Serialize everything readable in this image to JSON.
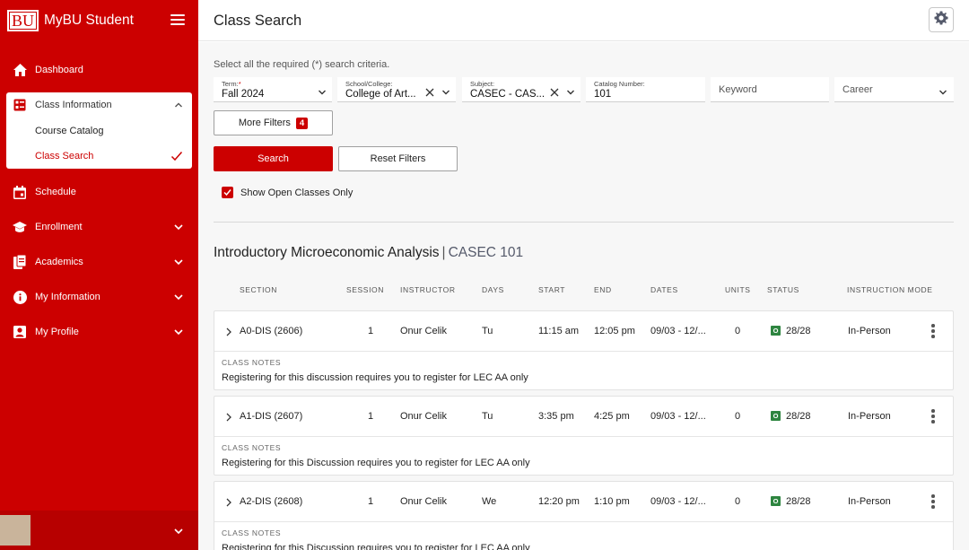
{
  "app": {
    "logo_text": "BU",
    "title": "MyBU Student"
  },
  "colors": {
    "brand": "#cc0000",
    "status_open": "#2e8540"
  },
  "sidebar": {
    "items": [
      {
        "label": "Dashboard",
        "icon": "home-icon"
      },
      {
        "label": "Class Information",
        "icon": "class-info-icon",
        "expanded": true,
        "children": [
          {
            "label": "Course Catalog"
          },
          {
            "label": "Class Search",
            "selected": true
          }
        ]
      },
      {
        "label": "Schedule",
        "icon": "calendar-icon"
      },
      {
        "label": "Enrollment",
        "icon": "graduation-cap-icon"
      },
      {
        "label": "Academics",
        "icon": "documents-icon"
      },
      {
        "label": "My Information",
        "icon": "info-icon"
      },
      {
        "label": "My Profile",
        "icon": "profile-icon"
      }
    ]
  },
  "header": {
    "title": "Class Search"
  },
  "form": {
    "hint": "Select all the required (*) search criteria.",
    "term": {
      "label": "Term:",
      "required_mark": "*",
      "value": "Fall 2024"
    },
    "school": {
      "label": "School/College:",
      "value": "College of Art..."
    },
    "subject": {
      "label": "Subject:",
      "value": "CASEC - CAS..."
    },
    "catalog": {
      "label": "Catalog Number:",
      "value": "101"
    },
    "keyword": {
      "placeholder": "Keyword"
    },
    "career": {
      "placeholder": "Career"
    },
    "more_filters": {
      "label": "More Filters",
      "count": "4"
    },
    "search_label": "Search",
    "reset_label": "Reset Filters",
    "open_only": {
      "label": "Show Open Classes Only",
      "checked": true
    }
  },
  "results": {
    "course_name": "Introductory Microeconomic Analysis",
    "separator": "|",
    "course_code": "CASEC 101",
    "columns": [
      "SECTION",
      "SESSION",
      "INSTRUCTOR",
      "DAYS",
      "START",
      "END",
      "DATES",
      "UNITS",
      "STATUS",
      "INSTRUCTION MODE"
    ],
    "notes_label": "CLASS NOTES",
    "status_letter": "O",
    "rows": [
      {
        "section": "A0-DIS (2606)",
        "session": "1",
        "instructor": "Onur Celik",
        "days": "Tu",
        "start": "11:15 am",
        "end": "12:05 pm",
        "dates": "09/03 - 12/...",
        "units": "0",
        "status": "28/28",
        "mode": "In-Person",
        "note": "Registering for this discussion requires you to register for LEC AA only"
      },
      {
        "section": "A1-DIS (2607)",
        "session": "1",
        "instructor": "Onur Celik",
        "days": "Tu",
        "start": "3:35 pm",
        "end": "4:25 pm",
        "dates": "09/03 - 12/...",
        "units": "0",
        "status": "28/28",
        "mode": "In-Person",
        "note": "Registering for this Discussion requires you to register for LEC AA only"
      },
      {
        "section": "A2-DIS (2608)",
        "session": "1",
        "instructor": "Onur Celik",
        "days": "We",
        "start": "12:20 pm",
        "end": "1:10 pm",
        "dates": "09/03 - 12/...",
        "units": "0",
        "status": "28/28",
        "mode": "In-Person",
        "note": "Registering for this Discussion requires you to register for LEC AA only"
      }
    ]
  }
}
